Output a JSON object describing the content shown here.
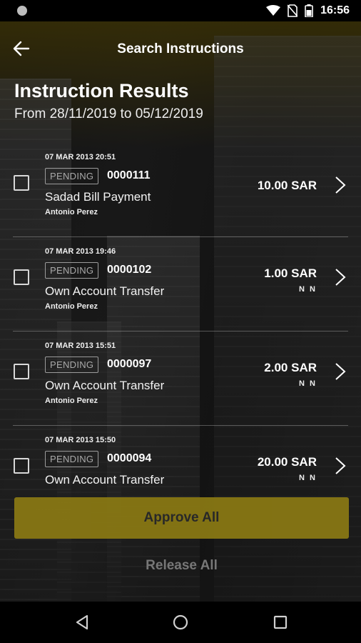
{
  "status_bar": {
    "time": "16:56",
    "icons": [
      "wifi-icon",
      "no-sim-icon",
      "battery-icon"
    ]
  },
  "header": {
    "title": "Search Instructions",
    "back_icon": "arrow-left-icon"
  },
  "results": {
    "title": "Instruction Results",
    "date_range": "From 28/11/2019 to 05/12/2019"
  },
  "instructions": [
    {
      "date": "07 MAR 2013 20:51",
      "status": "PENDING",
      "reference": "0000111",
      "type": "Sadad Bill Payment",
      "user": "Antonio Perez",
      "amount": "10.00 SAR",
      "subtext": ""
    },
    {
      "date": "07 MAR 2013 19:46",
      "status": "PENDING",
      "reference": "0000102",
      "type": "Own Account Transfer",
      "user": "Antonio Perez",
      "amount": "1.00 SAR",
      "subtext": "N N"
    },
    {
      "date": "07 MAR 2013 15:51",
      "status": "PENDING",
      "reference": "0000097",
      "type": "Own Account Transfer",
      "user": "Antonio Perez",
      "amount": "2.00 SAR",
      "subtext": "N N"
    },
    {
      "date": "07 MAR 2013 15:50",
      "status": "PENDING",
      "reference": "0000094",
      "type": "Own Account Transfer",
      "user": "",
      "amount": "20.00 SAR",
      "subtext": "N N"
    }
  ],
  "actions": {
    "approve_all": "Approve All",
    "release_all": "Release All"
  },
  "colors": {
    "accent": "#8b7a13",
    "background": "#1a1a1a",
    "badge_border": "#9b9b9b"
  }
}
